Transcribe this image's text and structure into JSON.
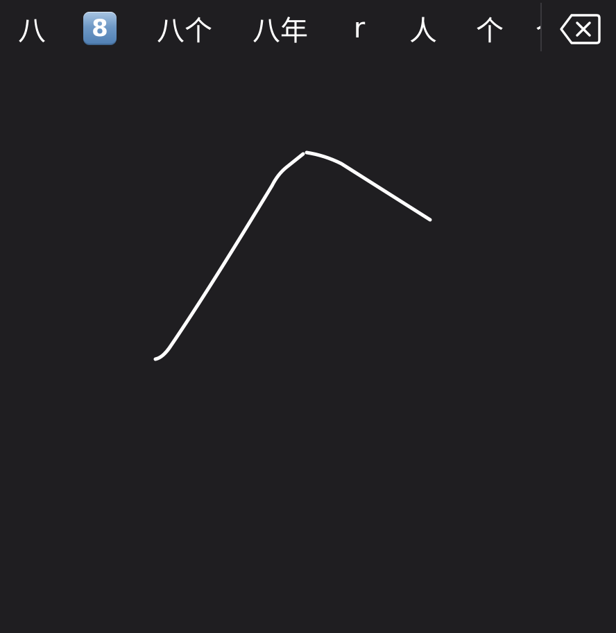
{
  "candidates": [
    {
      "text": "八",
      "type": "text"
    },
    {
      "text": "8",
      "type": "keycap"
    },
    {
      "text": "八个",
      "type": "text"
    },
    {
      "text": "八年",
      "type": "text"
    },
    {
      "text": "r",
      "type": "text"
    },
    {
      "text": "人",
      "type": "text"
    },
    {
      "text": "个",
      "type": "text"
    },
    {
      "text": "个",
      "type": "text-clipped"
    }
  ],
  "delete_icon": "delete-backspace-icon",
  "colors": {
    "background": "#1f1e21",
    "text": "#ffffff",
    "stroke": "#ffffff",
    "divider": "#3a393d",
    "keycap": "#6f99c6"
  }
}
